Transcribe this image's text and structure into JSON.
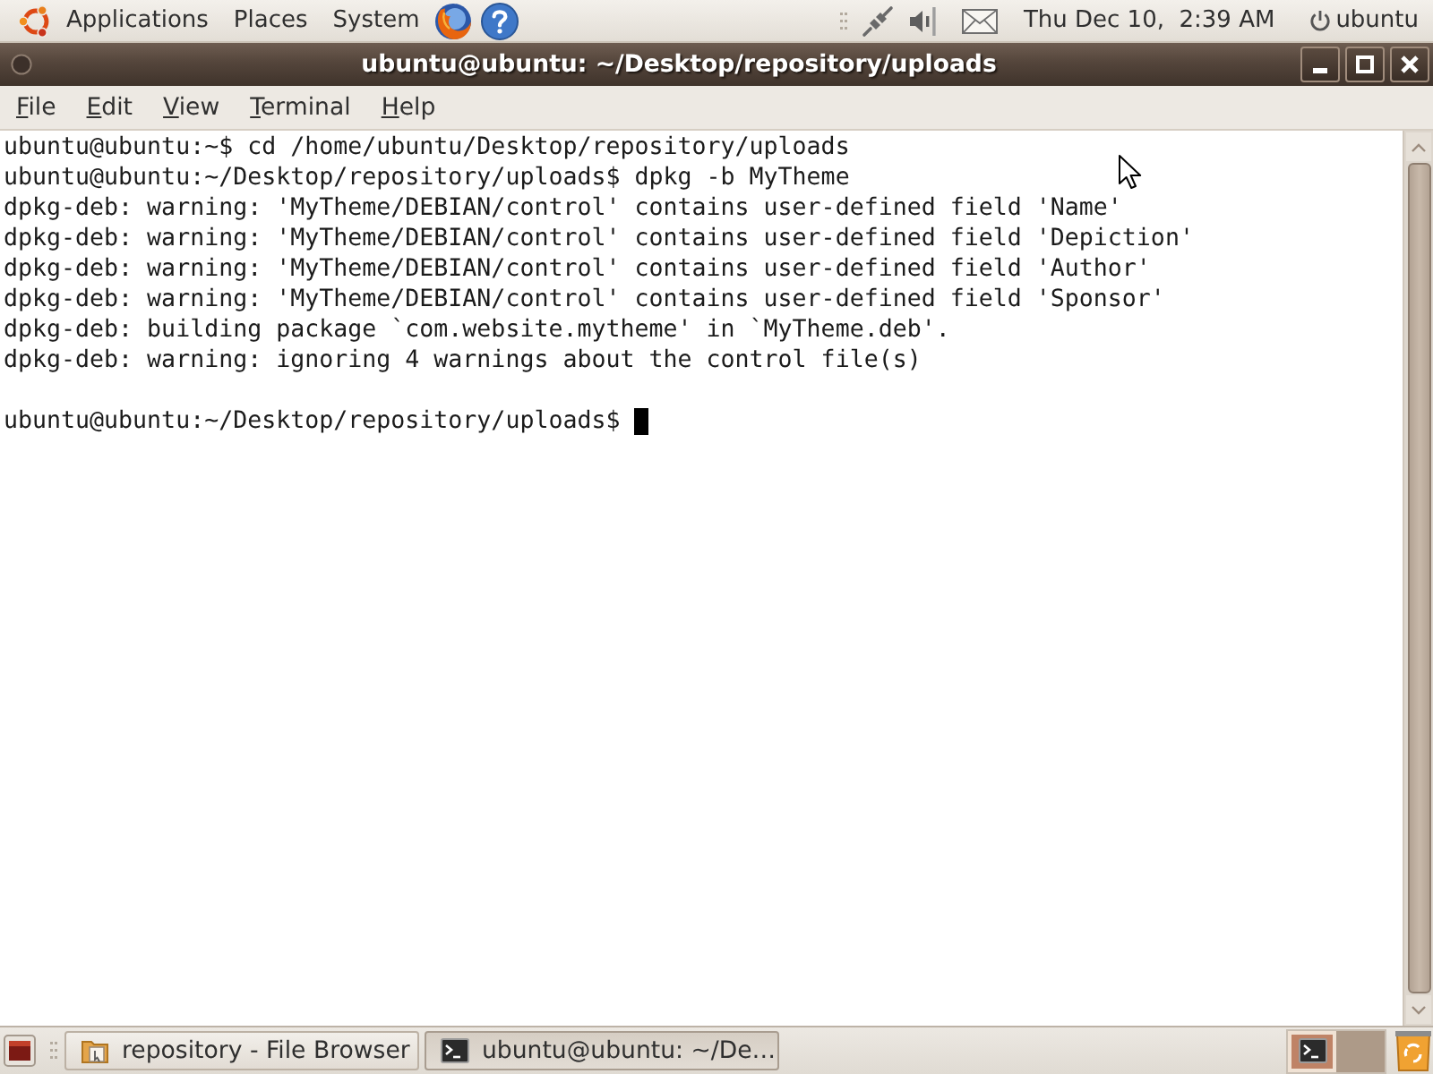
{
  "top_panel": {
    "menus": [
      "Applications",
      "Places",
      "System"
    ],
    "launchers": [
      {
        "kind": "firefox"
      },
      {
        "kind": "help"
      }
    ],
    "clock": "Thu Dec 10,  2:39 AM",
    "user": "ubuntu"
  },
  "window": {
    "title": "ubuntu@ubuntu: ~/Desktop/repository/uploads",
    "menu": [
      "File",
      "Edit",
      "View",
      "Terminal",
      "Help"
    ]
  },
  "terminal": {
    "lines": [
      "ubuntu@ubuntu:~$ cd /home/ubuntu/Desktop/repository/uploads",
      "ubuntu@ubuntu:~/Desktop/repository/uploads$ dpkg -b MyTheme",
      "dpkg-deb: warning: 'MyTheme/DEBIAN/control' contains user-defined field 'Name'",
      "dpkg-deb: warning: 'MyTheme/DEBIAN/control' contains user-defined field 'Depiction'",
      "dpkg-deb: warning: 'MyTheme/DEBIAN/control' contains user-defined field 'Author'",
      "dpkg-deb: warning: 'MyTheme/DEBIAN/control' contains user-defined field 'Sponsor'",
      "dpkg-deb: building package `com.website.mytheme' in `MyTheme.deb'.",
      "dpkg-deb: warning: ignoring 4 warnings about the control file(s)"
    ],
    "prompt": "ubuntu@ubuntu:~/Desktop/repository/uploads$"
  },
  "bottom_panel": {
    "tasks": [
      {
        "kind": "folder",
        "label": "repository - File Browser",
        "selected": false
      },
      {
        "kind": "terminal",
        "label": "ubuntu@ubuntu: ~/De…",
        "selected": true
      }
    ],
    "workspaces": [
      {
        "selected": true
      },
      {
        "selected": false
      }
    ]
  }
}
